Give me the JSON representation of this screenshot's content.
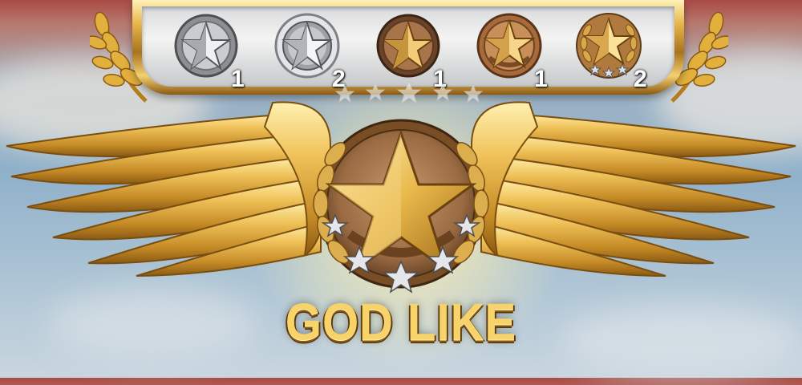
{
  "tier_bar": {
    "ranks": [
      {
        "icon": "silver-star-badge-icon",
        "count": "1"
      },
      {
        "icon": "silver-star-ring-badge-icon",
        "count": "2"
      },
      {
        "icon": "bronze-star-badge-icon",
        "count": "1"
      },
      {
        "icon": "bronze-star-chevron-badge-icon",
        "count": "1"
      },
      {
        "icon": "gold-star-laurel-badge-icon",
        "count": "2"
      }
    ]
  },
  "emblem": {
    "icon": "winged-gold-star-emblem-icon",
    "title": "GOD LIKE"
  },
  "colors": {
    "gold": "#e8b84a",
    "gold_dark": "#8a5a14",
    "silver": "#c9ccd0",
    "bronze": "#a86a3a"
  }
}
